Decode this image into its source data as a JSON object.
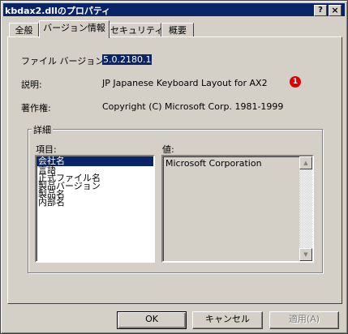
{
  "window": {
    "title": "kbdax2.dllのプロパティ",
    "help_glyph": "?",
    "close_glyph": "×"
  },
  "tabs": [
    {
      "label": "全般"
    },
    {
      "label": "バージョン情報"
    },
    {
      "label": "セキュリティ"
    },
    {
      "label": "概要"
    }
  ],
  "active_tab": "バージョン情報",
  "version_info": {
    "file_version_label": "ファイル バージョン:",
    "file_version_value": "5.0.2180.1",
    "description_label": "説明:",
    "description_value": "JP Japanese Keyboard Layout for AX2",
    "annotation_marker": "1",
    "copyright_label": "著作権:",
    "copyright_value": "Copyright (C) Microsoft Corp. 1981-1999"
  },
  "details": {
    "group_label": "詳細",
    "items_label": "項目:",
    "value_label": "値:",
    "items": [
      "会社名",
      "言語",
      "正式ファイル名",
      "製品バージョン",
      "製品名",
      "内部名"
    ],
    "selected_item": "会社名",
    "selected_value": "Microsoft Corporation"
  },
  "buttons": {
    "ok": "OK",
    "cancel": "キャンセル",
    "apply": "適用(A)"
  },
  "colors": {
    "titlebar": "#0a246a",
    "face": "#d4d0c8",
    "annotation": "#e00000"
  }
}
